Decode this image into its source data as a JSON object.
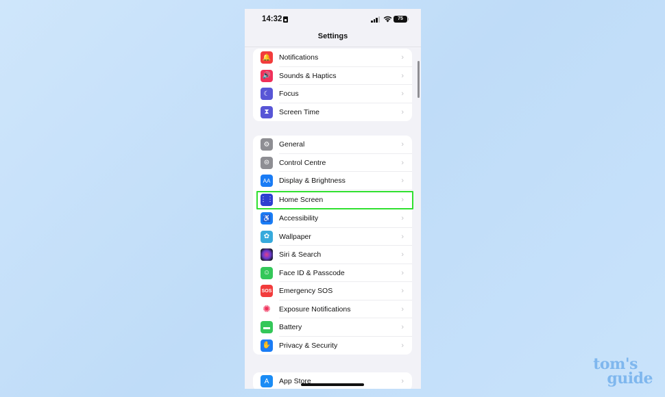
{
  "status_bar": {
    "time": "14:32",
    "battery_level": "75",
    "signal_bars_active": 3,
    "signal_bars_total": 4
  },
  "nav": {
    "title": "Settings"
  },
  "groups": [
    {
      "items": [
        {
          "label": "Notifications",
          "icon": "bell-icon",
          "color": "#f23c3c",
          "glyph": "🔔"
        },
        {
          "label": "Sounds & Haptics",
          "icon": "speaker-icon",
          "color": "#f0305a",
          "glyph": "🔊"
        },
        {
          "label": "Focus",
          "icon": "moon-icon",
          "color": "#5856d6",
          "glyph": "☾"
        },
        {
          "label": "Screen Time",
          "icon": "hourglass-icon",
          "color": "#5856d6",
          "glyph": "⧗"
        }
      ]
    },
    {
      "items": [
        {
          "label": "General",
          "icon": "gear-icon",
          "color": "#8e8e93",
          "glyph": "⚙"
        },
        {
          "label": "Control Centre",
          "icon": "toggles-icon",
          "color": "#8e8e93",
          "glyph": "⊜"
        },
        {
          "label": "Display & Brightness",
          "icon": "text-size-icon",
          "color": "#1a7cf5",
          "glyph": "AA"
        },
        {
          "label": "Home Screen",
          "icon": "home-screen-grid-icon",
          "color": "#2d3fd0",
          "glyph": "⋮⋮"
        },
        {
          "label": "Accessibility",
          "icon": "accessibility-icon",
          "color": "#1a7cf5",
          "glyph": "♿"
        },
        {
          "label": "Wallpaper",
          "icon": "flower-icon",
          "color": "#37aadc",
          "glyph": "✿"
        },
        {
          "label": "Siri & Search",
          "icon": "siri-icon",
          "color": "#2a1a3a",
          "glyph": "●"
        },
        {
          "label": "Face ID & Passcode",
          "icon": "face-id-icon",
          "color": "#34c759",
          "glyph": "☺"
        },
        {
          "label": "Emergency SOS",
          "icon": "sos-icon",
          "color": "#f23c3c",
          "glyph": "SOS"
        },
        {
          "label": "Exposure Notifications",
          "icon": "exposure-icon",
          "color": "#ffffff",
          "glyph": "✺"
        },
        {
          "label": "Battery",
          "icon": "battery-icon",
          "color": "#34c759",
          "glyph": "▬"
        },
        {
          "label": "Privacy & Security",
          "icon": "hand-icon",
          "color": "#1a7cf5",
          "glyph": "✋"
        }
      ]
    },
    {
      "items": [
        {
          "label": "App Store",
          "icon": "app-store-icon",
          "color": "#1a8cf5",
          "glyph": "A"
        }
      ]
    }
  ],
  "highlighted_item": "Home Screen",
  "watermark": {
    "line1": "tom's",
    "line2": "guide"
  }
}
